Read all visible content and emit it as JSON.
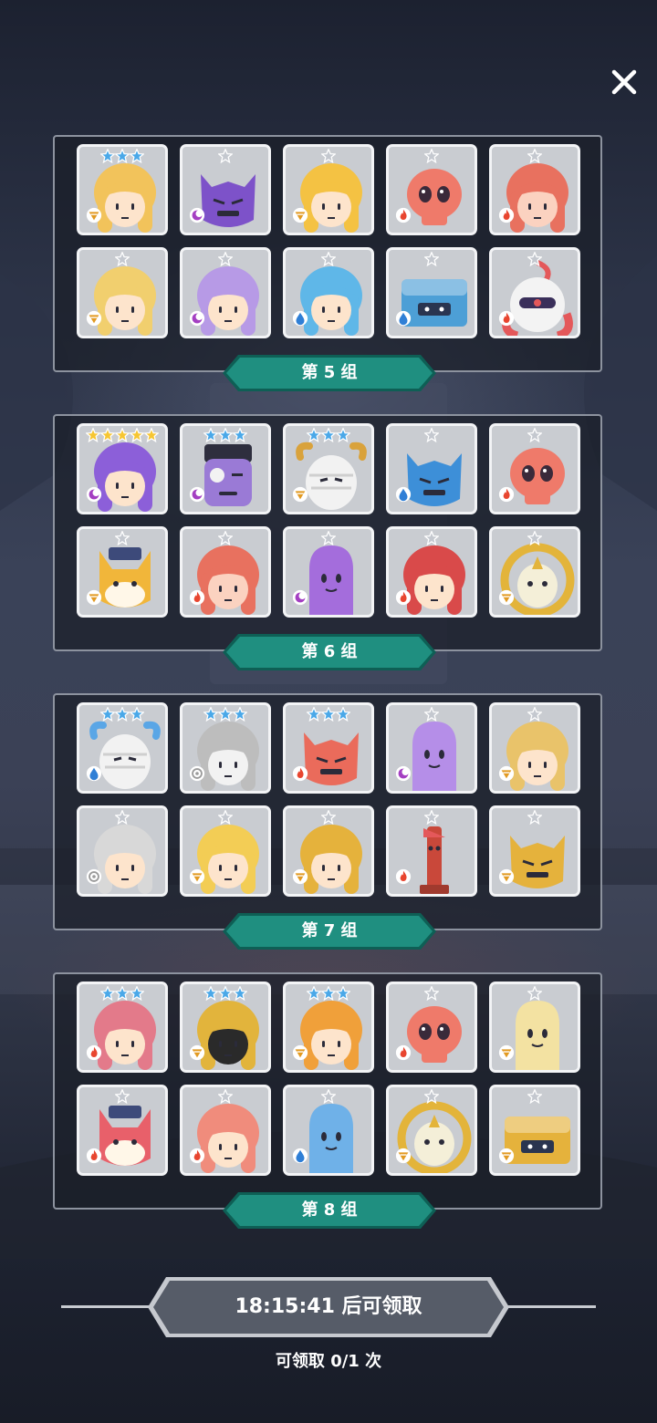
{
  "groups": [
    {
      "label": "第 5 组",
      "cards": [
        {
          "name": "blonde-curls-hero",
          "stars": 3,
          "star_color": "blue",
          "element": "earth",
          "color": "#f2c35b",
          "skin": "#fde4cc",
          "shape": "girl"
        },
        {
          "name": "purple-cat-demon",
          "stars": 1,
          "star_color": "silver",
          "element": "dark",
          "color": "#7d52c9",
          "skin": "#7d52c9",
          "shape": "monster"
        },
        {
          "name": "blonde-bow-girl",
          "stars": 1,
          "star_color": "silver",
          "element": "earth",
          "color": "#f4c243",
          "skin": "#fde4cc",
          "shape": "girl"
        },
        {
          "name": "red-skull",
          "stars": 1,
          "star_color": "silver",
          "element": "fire",
          "color": "#ef7a6a",
          "skin": "#ef7a6a",
          "shape": "skull"
        },
        {
          "name": "red-hat-girl",
          "stars": 1,
          "star_color": "silver",
          "element": "fire",
          "color": "#e8715f",
          "skin": "#fbd2c0",
          "shape": "girl"
        },
        {
          "name": "blonde-flower-girl",
          "stars": 1,
          "star_color": "silver",
          "element": "earth",
          "color": "#f1cf6e",
          "skin": "#fde4cc",
          "shape": "girl"
        },
        {
          "name": "lilac-flower-girl",
          "stars": 1,
          "star_color": "silver",
          "element": "dark",
          "color": "#b79ae6",
          "skin": "#fde4cc",
          "shape": "girl"
        },
        {
          "name": "blue-horn-girl",
          "stars": 1,
          "star_color": "silver",
          "element": "water",
          "color": "#5fb7e8",
          "skin": "#fde4cc",
          "shape": "girl"
        },
        {
          "name": "blue-treasure-chest",
          "stars": 1,
          "star_color": "silver",
          "element": "water",
          "color": "#4d9fd6",
          "skin": "#4d9fd6",
          "shape": "chest"
        },
        {
          "name": "red-knight",
          "stars": 1,
          "star_color": "silver",
          "element": "fire",
          "color": "#e4585a",
          "skin": "#f3f3f3",
          "shape": "knight"
        }
      ]
    },
    {
      "label": "第 6 组",
      "cards": [
        {
          "name": "purple-elf",
          "stars": 5,
          "star_color": "gold",
          "element": "dark",
          "color": "#8c5fd9",
          "skin": "#fde4cc",
          "shape": "girl"
        },
        {
          "name": "purple-zombie",
          "stars": 3,
          "star_color": "blue",
          "element": "dark",
          "color": "#8056c8",
          "skin": "#9a7ad6",
          "shape": "zombie"
        },
        {
          "name": "mummy-ram",
          "stars": 3,
          "star_color": "blue",
          "element": "earth",
          "color": "#d9a23b",
          "skin": "#f2f2f2",
          "shape": "mummy"
        },
        {
          "name": "blue-cat-demon",
          "stars": 1,
          "star_color": "silver",
          "element": "water",
          "color": "#3d8fd8",
          "skin": "#3d8fd8",
          "shape": "monster"
        },
        {
          "name": "red-skull",
          "stars": 1,
          "star_color": "silver",
          "element": "fire",
          "color": "#ef7a6a",
          "skin": "#ef7a6a",
          "shape": "skull"
        },
        {
          "name": "fox-police",
          "stars": 1,
          "star_color": "silver",
          "element": "earth",
          "color": "#f1b63a",
          "skin": "#f8d48a",
          "shape": "fox"
        },
        {
          "name": "red-hat-girl",
          "stars": 1,
          "star_color": "silver",
          "element": "fire",
          "color": "#e8715f",
          "skin": "#fbd2c0",
          "shape": "girl"
        },
        {
          "name": "purple-slime",
          "stars": 1,
          "star_color": "silver",
          "element": "dark",
          "color": "#a46ddc",
          "skin": "#a46ddc",
          "shape": "slime"
        },
        {
          "name": "card-queen",
          "stars": 1,
          "star_color": "silver",
          "element": "fire",
          "color": "#d94a4a",
          "skin": "#fde4cc",
          "shape": "girl"
        },
        {
          "name": "golden-sun-idol",
          "stars": 1,
          "star_color": "silver",
          "element": "earth",
          "color": "#e3b43a",
          "skin": "#f4efd8",
          "shape": "sun"
        }
      ]
    },
    {
      "label": "第 7 组",
      "cards": [
        {
          "name": "ice-ram-ghost",
          "stars": 3,
          "star_color": "blue",
          "element": "water",
          "color": "#5aa6e6",
          "skin": "#f2f2f2",
          "shape": "mummy"
        },
        {
          "name": "silver-priest",
          "stars": 3,
          "star_color": "blue",
          "element": "light",
          "color": "#bdbdbd",
          "skin": "#f2f2f2",
          "shape": "girl"
        },
        {
          "name": "red-cyclops",
          "stars": 3,
          "star_color": "blue",
          "element": "fire",
          "color": "#ea6b5b",
          "skin": "#ea6b5b",
          "shape": "monster"
        },
        {
          "name": "purple-ghost",
          "stars": 1,
          "star_color": "silver",
          "element": "dark",
          "color": "#b58ee8",
          "skin": "#b58ee8",
          "shape": "slime"
        },
        {
          "name": "gold-helm-girl",
          "stars": 1,
          "star_color": "silver",
          "element": "earth",
          "color": "#e9c36a",
          "skin": "#fde4cc",
          "shape": "girl"
        },
        {
          "name": "white-witch",
          "stars": 1,
          "star_color": "silver",
          "element": "light",
          "color": "#d8d8d8",
          "skin": "#fde4cc",
          "shape": "girl"
        },
        {
          "name": "blonde-horn-girl",
          "stars": 1,
          "star_color": "silver",
          "element": "earth",
          "color": "#f3cd55",
          "skin": "#fde4cc",
          "shape": "girl"
        },
        {
          "name": "gold-crown-king",
          "stars": 1,
          "star_color": "silver",
          "element": "earth",
          "color": "#e5b23c",
          "skin": "#fde4cc",
          "shape": "girl"
        },
        {
          "name": "red-totem",
          "stars": 1,
          "star_color": "silver",
          "element": "fire",
          "color": "#c9483a",
          "skin": "#c9483a",
          "shape": "totem"
        },
        {
          "name": "gold-dragon",
          "stars": 1,
          "star_color": "silver",
          "element": "earth",
          "color": "#e5b23c",
          "skin": "#e5b23c",
          "shape": "monster"
        }
      ]
    },
    {
      "label": "第 8 组",
      "cards": [
        {
          "name": "pirate-girl",
          "stars": 3,
          "star_color": "blue",
          "element": "fire",
          "color": "#e37a8a",
          "skin": "#fde4cc",
          "shape": "girl"
        },
        {
          "name": "shadow-golden-king",
          "stars": 3,
          "star_color": "blue",
          "element": "earth",
          "color": "#e2b43c",
          "skin": "#2a2a2a",
          "shape": "girl"
        },
        {
          "name": "crown-princess",
          "stars": 3,
          "star_color": "blue",
          "element": "earth",
          "color": "#f0a03a",
          "skin": "#fde4cc",
          "shape": "girl"
        },
        {
          "name": "red-skull",
          "stars": 1,
          "star_color": "silver",
          "element": "fire",
          "color": "#ef7a6a",
          "skin": "#ef7a6a",
          "shape": "skull"
        },
        {
          "name": "cream-ghost",
          "stars": 1,
          "star_color": "silver",
          "element": "earth",
          "color": "#f3e2a2",
          "skin": "#f3e2a2",
          "shape": "slime"
        },
        {
          "name": "red-fox-police",
          "stars": 1,
          "star_color": "silver",
          "element": "fire",
          "color": "#e8606a",
          "skin": "#f49aa0",
          "shape": "fox"
        },
        {
          "name": "pink-cat-girl",
          "stars": 1,
          "star_color": "silver",
          "element": "fire",
          "color": "#f08c7c",
          "skin": "#fde4cc",
          "shape": "girl"
        },
        {
          "name": "blue-slime",
          "stars": 1,
          "star_color": "silver",
          "element": "water",
          "color": "#6fb1e8",
          "skin": "#6fb1e8",
          "shape": "slime"
        },
        {
          "name": "golden-sun-idol",
          "stars": 1,
          "star_color": "silver",
          "element": "earth",
          "color": "#e3b43a",
          "skin": "#f4efd8",
          "shape": "sun"
        },
        {
          "name": "gold-treasure-chest",
          "stars": 1,
          "star_color": "silver",
          "element": "earth",
          "color": "#e5b23c",
          "skin": "#e5b23c",
          "shape": "chest"
        }
      ]
    }
  ],
  "timer_label": "18:15:41 后可领取",
  "claim_label": "可领取 0/1 次",
  "colors": {
    "label_fill": "#1f8f80",
    "label_border": "#0e5f55",
    "timer_fill": "#555b66",
    "star_blue": "#4aa8e8",
    "star_gold": "#f6c633",
    "star_silver": "#c4c8cf"
  },
  "icons": {
    "close": "close-icon",
    "fire": "fire-icon",
    "water": "water-drop-icon",
    "dark": "moon-icon",
    "earth": "earth-wedge-icon",
    "light": "sun-gear-icon"
  }
}
